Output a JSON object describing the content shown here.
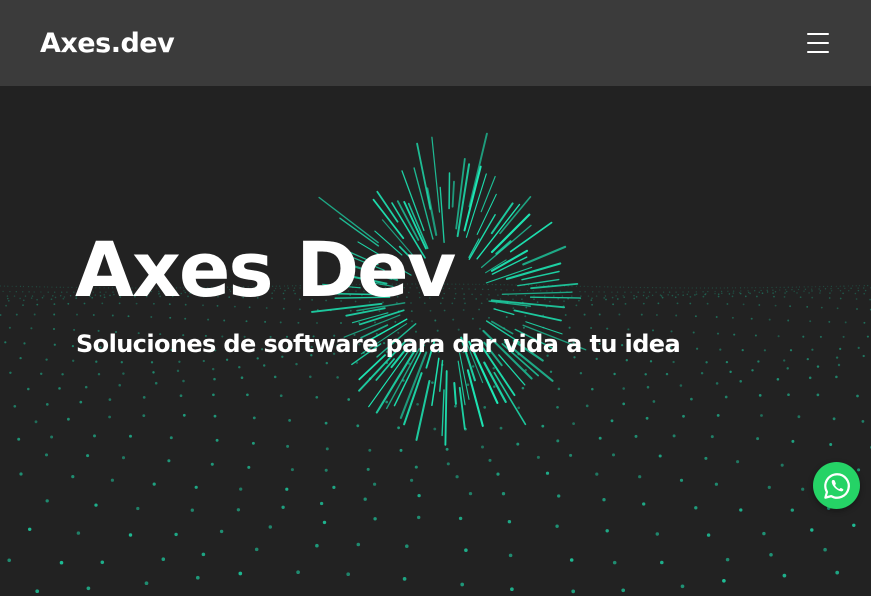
{
  "navbar": {
    "brand": "Axes.dev",
    "menu_icon": "hamburger-menu-icon"
  },
  "hero": {
    "title": "Axes Dev",
    "subtitle": "Soluciones de software para dar vida a tu idea",
    "background": "particle-wave-with-burst"
  },
  "floating": {
    "whatsapp_icon": "whatsapp-icon"
  },
  "colors": {
    "navbar_bg": "#3b3b3b",
    "hero_bg": "#222222",
    "accent": "#1de9b6",
    "text": "#ffffff",
    "whatsapp": "#25d366"
  }
}
